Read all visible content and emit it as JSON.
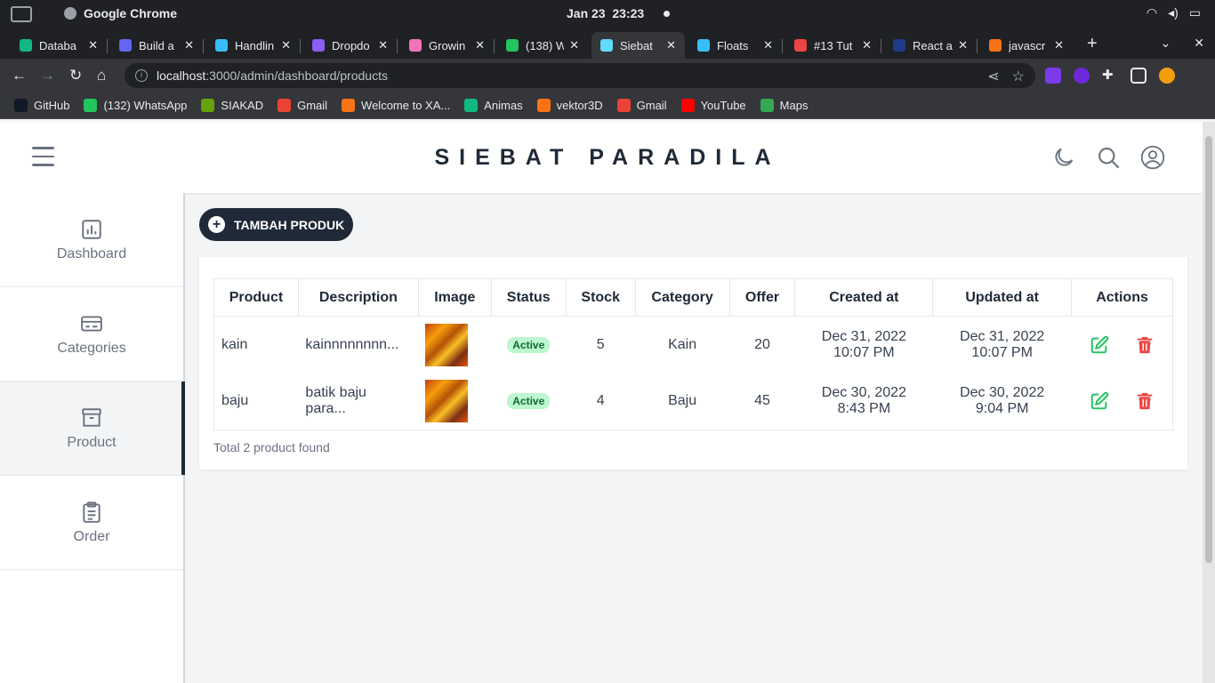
{
  "os": {
    "app_name": "Google Chrome",
    "date": "Jan 23",
    "time": "23:23"
  },
  "browser": {
    "tabs": [
      {
        "title": "Databa",
        "color": "#10b981"
      },
      {
        "title": "Build a",
        "color": "#6366f1"
      },
      {
        "title": "Handlin",
        "color": "#38bdf8"
      },
      {
        "title": "Dropdo",
        "color": "#8b5cf6"
      },
      {
        "title": "Growin",
        "color": "#f472b6"
      },
      {
        "title": "(138) W",
        "color": "#22c55e"
      },
      {
        "title": "Siebat",
        "color": "#61dafb"
      },
      {
        "title": "Floats",
        "color": "#38bdf8"
      },
      {
        "title": "#13 Tut",
        "color": "#ef4444"
      },
      {
        "title": "React a",
        "color": "#1e3a8a"
      },
      {
        "title": "javascr",
        "color": "#f97316"
      }
    ],
    "active_tab_index": 6,
    "url_host": "localhost",
    "url_path": ":3000/admin/dashboard/products",
    "bookmarks": [
      {
        "label": "GitHub",
        "color": "#111827"
      },
      {
        "label": "(132) WhatsApp",
        "color": "#22c55e"
      },
      {
        "label": "SIAKAD",
        "color": "#65a30d"
      },
      {
        "label": "Gmail",
        "color": "#ea4335"
      },
      {
        "label": "Welcome to XA...",
        "color": "#f97316"
      },
      {
        "label": "Animas",
        "color": "#10b981"
      },
      {
        "label": "vektor3D",
        "color": "#f97316"
      },
      {
        "label": "Gmail",
        "color": "#ea4335"
      },
      {
        "label": "YouTube",
        "color": "#ff0000"
      },
      {
        "label": "Maps",
        "color": "#34a853"
      }
    ]
  },
  "header": {
    "brand": "SIEBAT PARADILA"
  },
  "sidebar": {
    "items": [
      {
        "label": "Dashboard",
        "icon": "chart-icon"
      },
      {
        "label": "Categories",
        "icon": "card-icon"
      },
      {
        "label": "Product",
        "icon": "archive-icon"
      },
      {
        "label": "Order",
        "icon": "clipboard-icon"
      }
    ],
    "active": "Product"
  },
  "main": {
    "add_button": "TAMBAH PRODUK",
    "columns": [
      "Product",
      "Description",
      "Image",
      "Status",
      "Stock",
      "Category",
      "Offer",
      "Created at",
      "Updated at",
      "Actions"
    ],
    "rows": [
      {
        "product": "kain",
        "description": "kainnnnnnnn...",
        "status": "Active",
        "stock": "5",
        "category": "Kain",
        "offer": "20",
        "created_date": "Dec 31, 2022",
        "created_time": "10:07 PM",
        "updated_date": "Dec 31, 2022",
        "updated_time": "10:07 PM"
      },
      {
        "product": "baju",
        "description_line1": "batik baju",
        "description_line2": "para...",
        "status": "Active",
        "stock": "4",
        "category": "Baju",
        "offer": "45",
        "created_date": "Dec 30, 2022",
        "created_time": "8:43 PM",
        "updated_date": "Dec 30, 2022",
        "updated_time": "9:04 PM"
      }
    ],
    "footer": "Total 2 product found"
  },
  "colors": {
    "edit": "#22c55e",
    "delete": "#ef4444",
    "active_badge_bg": "#bbf7d0",
    "dark": "#1f2937"
  }
}
